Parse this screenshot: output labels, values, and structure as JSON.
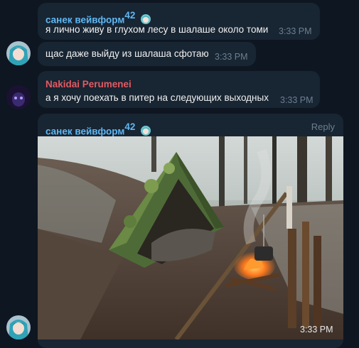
{
  "messages": [
    {
      "sender": "санек вейвформ",
      "badge": "42",
      "text": "я лично живу в глухом лесу в шалаше около томи",
      "time": "3:33 PM"
    },
    {
      "text": "щас даже выйду из шалаша сфотаю",
      "time": "3:33 PM"
    },
    {
      "sender": "Nakidai Perumenei",
      "text": "а я хочу поехать в питер на следующих выходных",
      "time": "3:33 PM"
    },
    {
      "sender": "санек вейвформ",
      "badge": "42",
      "reply_label": "Reply",
      "photo_time": "3:33 PM"
    }
  ],
  "colors": {
    "background": "#0e1621",
    "bubble": "#182533",
    "sender_blue": "#5fb7f3",
    "sender_red": "#e35a62",
    "timestamp": "#6d7f8f"
  },
  "icons": {
    "badge_emoji": "anime-girl-emoji",
    "avatar_1": "anime-girl-avatar",
    "avatar_2": "dark-purple-avatar"
  }
}
